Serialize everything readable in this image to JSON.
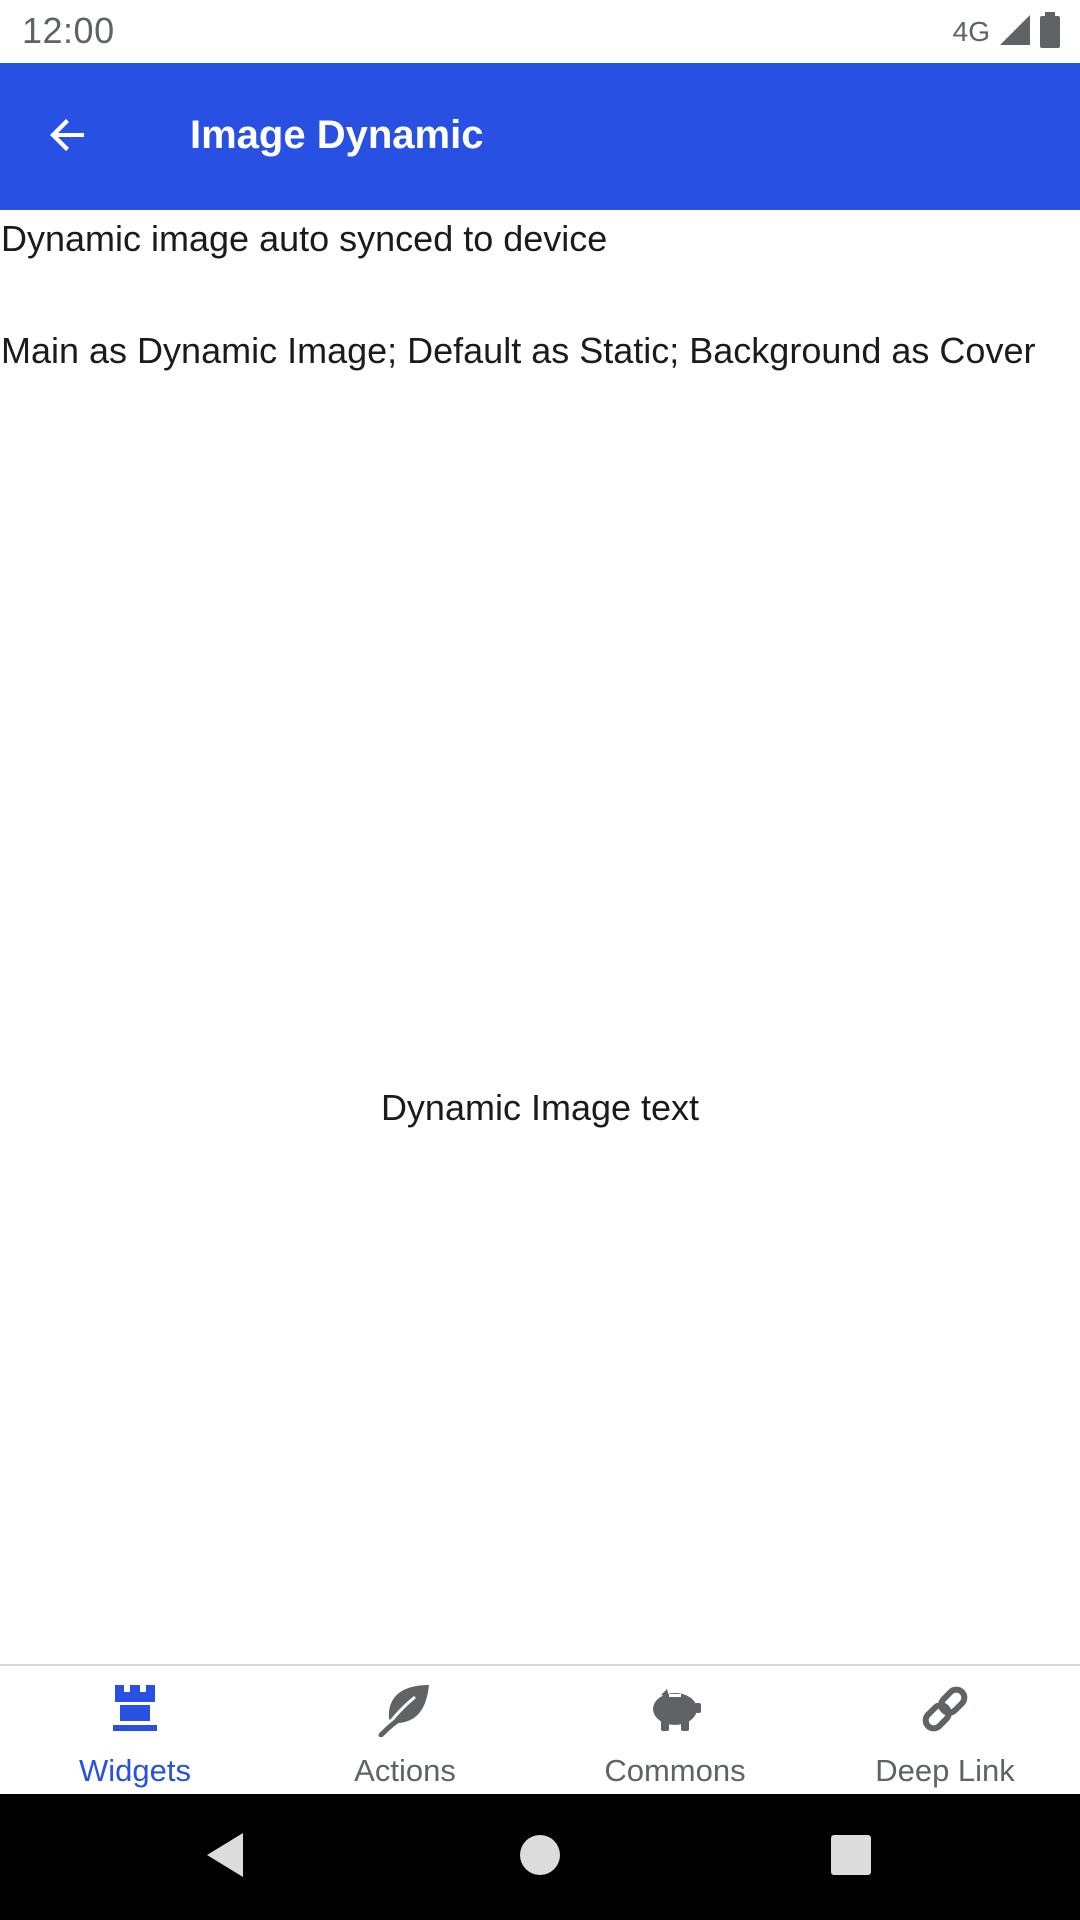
{
  "status_bar": {
    "time": "12:00",
    "network": "4G",
    "signal_icon": "signal-icon",
    "battery_icon": "battery-icon"
  },
  "app_bar": {
    "title": "Image Dynamic",
    "back_icon": "arrow-back-icon",
    "background_color": "#2850e3"
  },
  "content": {
    "line1": "Dynamic image auto synced to device",
    "line2": "Main as Dynamic Image; Default as Static; Background as Cover",
    "image_text": "Dynamic Image text"
  },
  "bottom_nav": {
    "items": [
      {
        "label": "Widgets",
        "icon": "chess-rook-icon",
        "active": true
      },
      {
        "label": "Actions",
        "icon": "leaf-icon",
        "active": false
      },
      {
        "label": "Commons",
        "icon": "piggy-bank-icon",
        "active": false
      },
      {
        "label": "Deep Link",
        "icon": "link-icon",
        "active": false
      }
    ],
    "active_color": "#2850e3",
    "inactive_color": "#5f6368"
  },
  "system_nav": {
    "back_icon": "triangle-back-icon",
    "home_icon": "circle-home-icon",
    "recents_icon": "square-recents-icon"
  }
}
